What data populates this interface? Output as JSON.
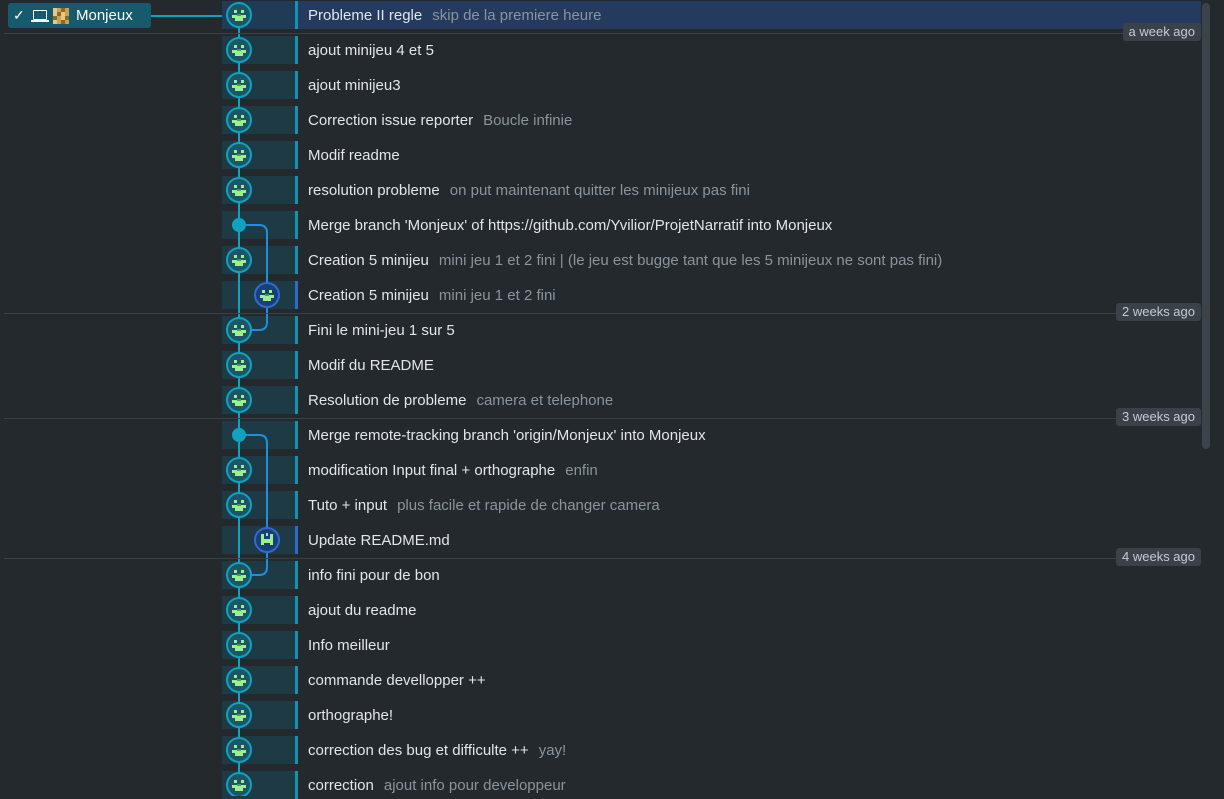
{
  "branch": {
    "check_icon": "check-icon",
    "computer_icon": "laptop-icon",
    "name": "Monjeux"
  },
  "commits": [
    {
      "message": "Probleme II regle",
      "description": "skip de la premiere heure",
      "lane": 0,
      "kind": "avatar",
      "selected": true
    },
    {
      "message": "ajout minijeu 4 et 5",
      "description": "",
      "lane": 0,
      "kind": "avatar"
    },
    {
      "message": "ajout minijeu3",
      "description": "",
      "lane": 0,
      "kind": "avatar"
    },
    {
      "message": "Correction issue reporter",
      "description": "Boucle infinie",
      "lane": 0,
      "kind": "avatar"
    },
    {
      "message": "Modif readme",
      "description": "",
      "lane": 0,
      "kind": "avatar"
    },
    {
      "message": "resolution probleme",
      "description": "on put maintenant quitter les minijeux pas fini",
      "lane": 0,
      "kind": "avatar"
    },
    {
      "message": "Merge branch 'Monjeux' of https://github.com/Yvilior/ProjetNarratif into Monjeux",
      "description": "",
      "lane": 0,
      "kind": "merge"
    },
    {
      "message": "Creation 5 minijeu",
      "description": "mini jeu 1 et 2 fini | (le jeu est bugge tant que les 5 minijeux ne sont pas fini)",
      "lane": 0,
      "kind": "avatar"
    },
    {
      "message": "Creation 5 minijeu",
      "description": "mini jeu 1 et 2 fini",
      "lane": 1,
      "kind": "avatar"
    },
    {
      "message": "Fini le mini-jeu 1 sur 5",
      "description": "",
      "lane": 0,
      "kind": "avatar"
    },
    {
      "message": "Modif du README",
      "description": "",
      "lane": 0,
      "kind": "avatar"
    },
    {
      "message": "Resolution de probleme",
      "description": "camera et telephone",
      "lane": 0,
      "kind": "avatar"
    },
    {
      "message": "Merge remote-tracking branch 'origin/Monjeux' into Monjeux",
      "description": "",
      "lane": 0,
      "kind": "merge"
    },
    {
      "message": "modification Input final + orthographe",
      "description": "enfin",
      "lane": 0,
      "kind": "avatar"
    },
    {
      "message": "Tuto + input",
      "description": "plus facile et rapide de changer camera",
      "lane": 0,
      "kind": "avatar"
    },
    {
      "message": "Update README.md",
      "description": "",
      "lane": 1,
      "kind": "github"
    },
    {
      "message": "info fini pour de bon",
      "description": "",
      "lane": 0,
      "kind": "avatar"
    },
    {
      "message": "ajout du readme",
      "description": "",
      "lane": 0,
      "kind": "avatar"
    },
    {
      "message": "Info meilleur",
      "description": "",
      "lane": 0,
      "kind": "avatar"
    },
    {
      "message": "commande devellopper ++",
      "description": "",
      "lane": 0,
      "kind": "avatar"
    },
    {
      "message": "orthographe!",
      "description": "",
      "lane": 0,
      "kind": "avatar"
    },
    {
      "message": "correction des bug et difficulte ++",
      "description": "yay!",
      "lane": 0,
      "kind": "avatar"
    },
    {
      "message": "correction",
      "description": "ajout info pour developpeur",
      "lane": 0,
      "kind": "avatar"
    }
  ],
  "date_markers": [
    {
      "label": "a week ago",
      "after_row": 0
    },
    {
      "label": "2 weeks ago",
      "after_row": 8
    },
    {
      "label": "3 weeks ago",
      "after_row": 11
    },
    {
      "label": "4 weeks ago",
      "after_row": 15
    }
  ],
  "colors": {
    "background": "#24292e",
    "lane_main": "#0fa3c0",
    "lane_branch": "#2d6ccc",
    "selected_row": "#243a5e"
  }
}
